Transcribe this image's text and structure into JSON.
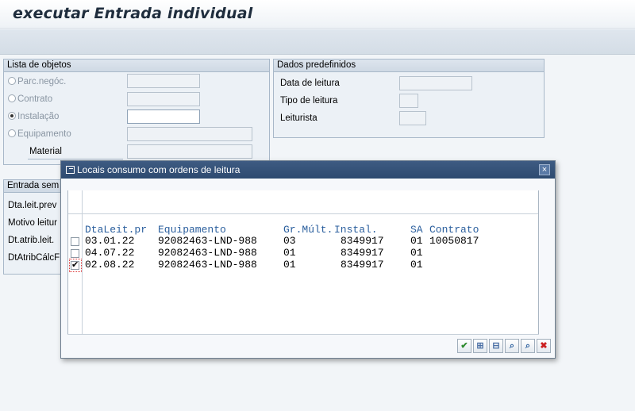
{
  "window": {
    "title": "executar Entrada individual"
  },
  "lista": {
    "header": "Lista de objetos",
    "items": [
      {
        "label": "Parc.negóc.",
        "selected": false
      },
      {
        "label": "Contrato",
        "selected": false
      },
      {
        "label": "Instalação",
        "selected": true
      },
      {
        "label": "Equipamento",
        "selected": false
      }
    ],
    "material_label": "Material"
  },
  "dados": {
    "header": "Dados predefinidos",
    "items": [
      "Data de leitura",
      "Tipo de leitura",
      "Leiturista"
    ]
  },
  "entrada": {
    "header": "Entrada sem",
    "labels": [
      "Dta.leit.prev",
      "Motivo leitur",
      "Dt.atrib.leit.",
      "DtAtribCálcF"
    ]
  },
  "dialog": {
    "title": "Locais consumo com ordens de leitura",
    "close_label": "×",
    "columns": [
      "DtaLeit.pr",
      "Equipamento",
      "Gr.Múlt.",
      "Instal.",
      "SA",
      "Contrato"
    ],
    "rows": [
      {
        "selected": false,
        "date": "03.01.22",
        "equip": "92082463-LND-988",
        "gr": "03",
        "instal": "8349917",
        "sa": "01",
        "contrato": "10050817"
      },
      {
        "selected": false,
        "date": "04.07.22",
        "equip": "92082463-LND-988",
        "gr": "01",
        "instal": "8349917",
        "sa": "01",
        "contrato": ""
      },
      {
        "selected": true,
        "date": "02.08.22",
        "equip": "92082463-LND-988",
        "gr": "01",
        "instal": "8349917",
        "sa": "01",
        "contrato": ""
      }
    ],
    "buttons": [
      {
        "name": "ok-button",
        "glyph": "✔",
        "color": "#2e8b2e"
      },
      {
        "name": "select-block-button",
        "glyph": "⊞",
        "color": "#4a6fa5"
      },
      {
        "name": "deselect-button",
        "glyph": "⊟",
        "color": "#4a6fa5"
      },
      {
        "name": "find-button",
        "glyph": "⌕",
        "color": "#2b5f9e"
      },
      {
        "name": "find-next-button",
        "glyph": "⌕",
        "color": "#2b5f9e"
      },
      {
        "name": "cancel-button",
        "glyph": "✖",
        "color": "#cc2020"
      }
    ]
  }
}
